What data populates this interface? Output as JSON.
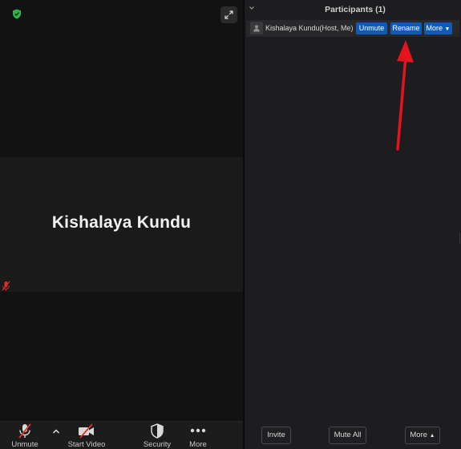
{
  "video": {
    "participant_name": "Kishalaya Kundu"
  },
  "toolbar": {
    "unmute_label": "Unmute",
    "start_video_label": "Start Video",
    "security_label": "Security",
    "more_label": "More"
  },
  "participants": {
    "title": "Participants (1)",
    "items": [
      {
        "name": "Kishalaya Kundu(Host, Me)",
        "unmute_label": "Unmute",
        "rename_label": "Rename",
        "more_label": "More"
      }
    ],
    "footer": {
      "invite_label": "Invite",
      "mute_all_label": "Mute All",
      "more_label": "More"
    }
  },
  "colors": {
    "accent_blue": "#0e5ab5",
    "shield_green": "#2fb34a",
    "muted_red": "#e0312c",
    "annotation_red": "#e3141c"
  }
}
